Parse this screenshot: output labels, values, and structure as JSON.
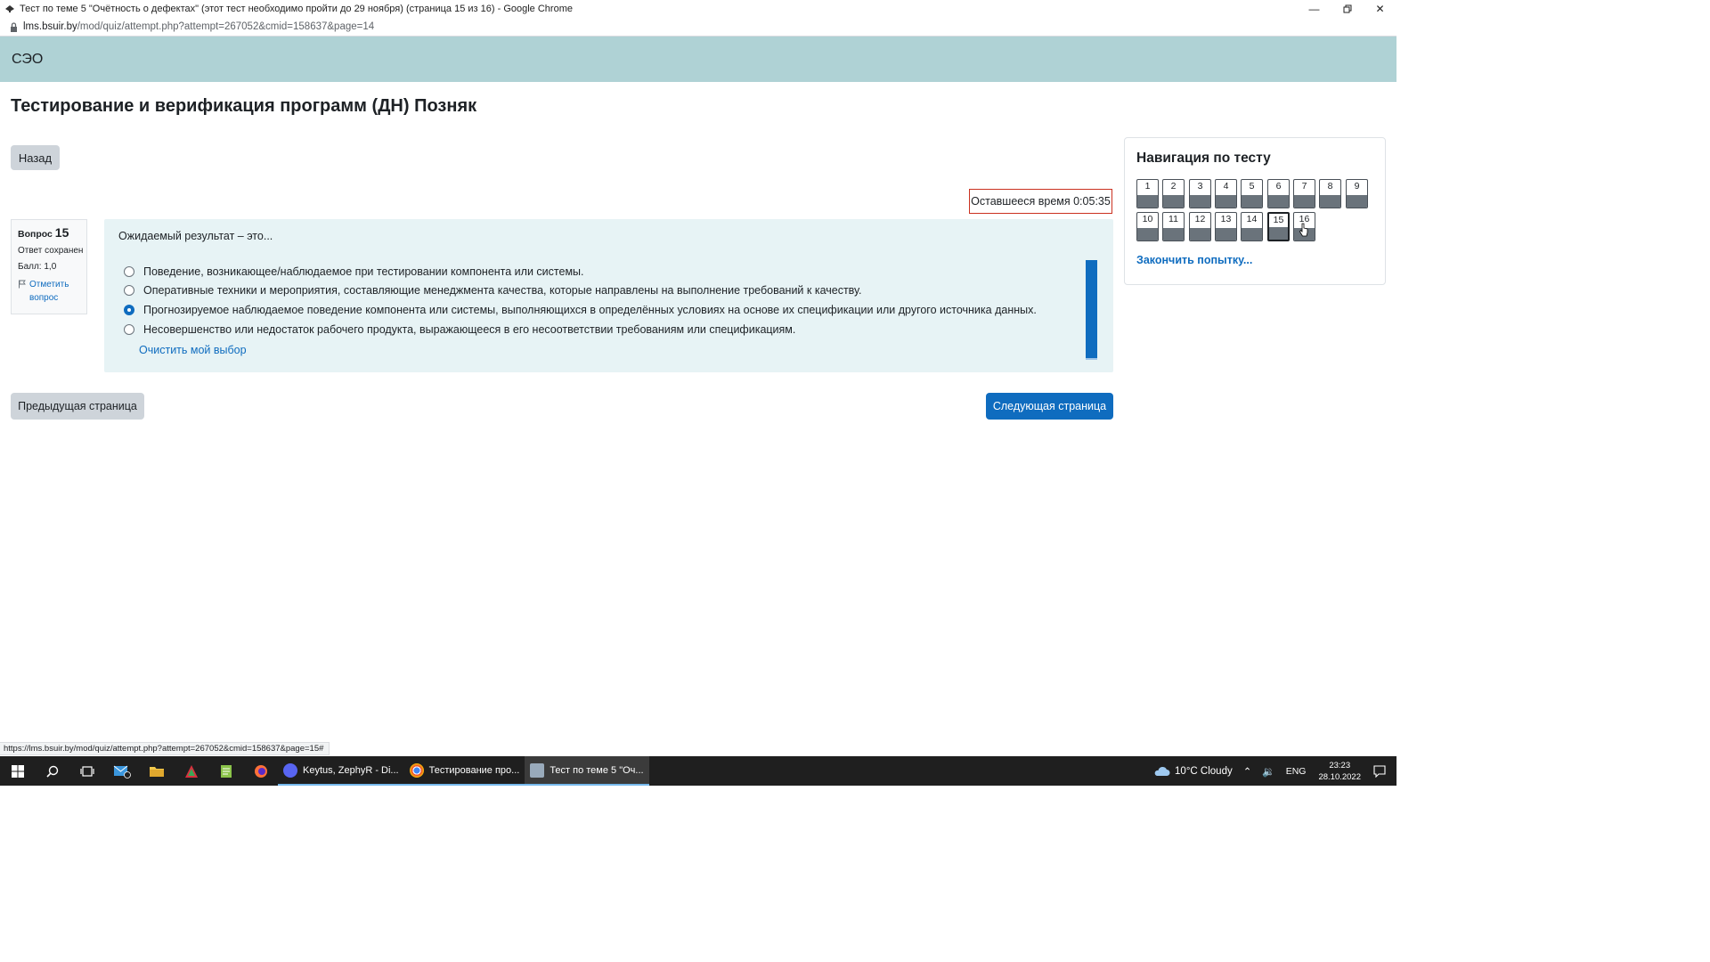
{
  "window": {
    "title": "Тест по теме 5 \"Очётность о дефектах\" (этот тест необходимо пройти до 29 ноября) (страница 15 из 16) - Google Chrome"
  },
  "address": {
    "host": "lms.bsuir.by",
    "path": "/mod/quiz/attempt.php?attempt=267052&cmid=158637&page=14"
  },
  "site": {
    "brand": "СЭО"
  },
  "page": {
    "title": "Тестирование и верификация программ (ДН) Позняк",
    "back_label": "Назад",
    "timer_label": "Оставшееся время 0:05:35"
  },
  "question_info": {
    "label": "Вопрос",
    "number": "15",
    "status": "Ответ сохранен",
    "grade": "Балл: 1,0",
    "flag_label": "Отметить вопрос"
  },
  "question": {
    "text": "Ожидаемый результат – это...",
    "answers": [
      {
        "text": "Поведение, возникающее/наблюдаемое при тестировании компонента или системы.",
        "selected": false
      },
      {
        "text": "Оперативные техники и мероприятия, составляющие менеджмента качества, которые направлены на выполнение требований к качеству.",
        "selected": false
      },
      {
        "text": "Прогнозируемое наблюдаемое поведение компонента или системы, выполняющихся в определённых условиях на основе их спецификации или другого источника данных.",
        "selected": true
      },
      {
        "text": "Несовершенство или недостаток рабочего продукта, выражающееся в его несоответствии требованиям или спецификациям.",
        "selected": false
      }
    ],
    "clear_label": "Очистить мой выбор"
  },
  "footer_nav": {
    "prev_label": "Предыдущая страница",
    "next_label": "Следующая страница"
  },
  "quiz_nav": {
    "title": "Навигация по тесту",
    "buttons": [
      "1",
      "2",
      "3",
      "4",
      "5",
      "6",
      "7",
      "8",
      "9",
      "10",
      "11",
      "12",
      "13",
      "14",
      "15",
      "16"
    ],
    "current": "15",
    "finish_label": "Закончить попытку..."
  },
  "statusbar": {
    "url": "https://lms.bsuir.by/mod/quiz/attempt.php?attempt=267052&cmid=158637&page=15#"
  },
  "taskbar": {
    "apps": [
      {
        "label": "Keytus, ZephyR - Di...",
        "icon": "discord-icon",
        "active": false
      },
      {
        "label": "Тестирование про...",
        "icon": "chrome-icon",
        "active": false
      },
      {
        "label": "Тест по теме 5 \"Оч...",
        "icon": "moodle-icon",
        "active": true
      }
    ],
    "weather": "10°C  Cloudy",
    "lang": "ENG",
    "time": "23:23",
    "date": "28.10.2022"
  },
  "colors": {
    "header_bg": "#afd2d5",
    "primary": "#0f6cbf",
    "question_bg": "#e7f3f5",
    "timer_border": "#ca3120"
  }
}
